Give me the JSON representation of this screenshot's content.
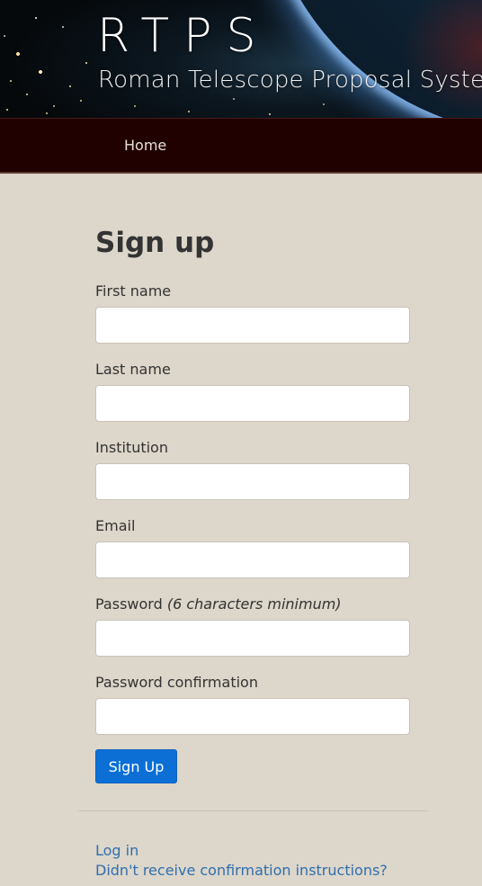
{
  "header": {
    "title": "RTPS",
    "subtitle": "Roman Telescope Proposal System"
  },
  "nav": {
    "items": [
      {
        "label": "Home"
      }
    ]
  },
  "form": {
    "title": "Sign up",
    "fields": [
      {
        "label": "First name",
        "value": ""
      },
      {
        "label": "Last name",
        "value": ""
      },
      {
        "label": "Institution",
        "value": ""
      },
      {
        "label": "Email",
        "value": ""
      },
      {
        "label": "Password",
        "hint": "(6 characters minimum)",
        "value": ""
      },
      {
        "label": "Password confirmation",
        "value": ""
      }
    ],
    "submit_label": "Sign Up"
  },
  "links": {
    "login": "Log in",
    "confirmation": "Didn't receive confirmation instructions?"
  },
  "colors": {
    "background": "#ddd6ca",
    "navbar": "#200100",
    "button": "#0b6fd6",
    "link": "#2f6fae"
  }
}
